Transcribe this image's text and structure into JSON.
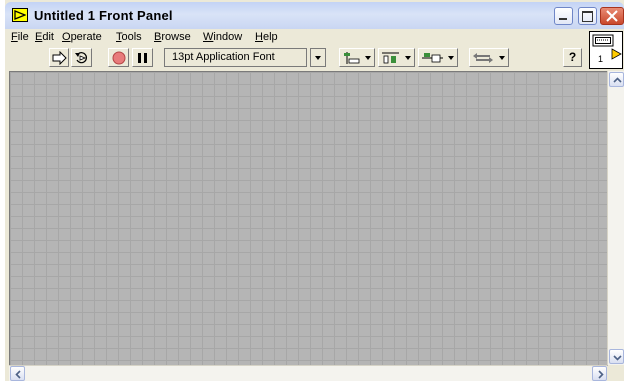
{
  "window": {
    "title": "Untitled 1 Front Panel"
  },
  "menu": [
    {
      "label": "File",
      "mnemonic": "F",
      "rest": "ile"
    },
    {
      "label": "Edit",
      "mnemonic": "E",
      "rest": "dit"
    },
    {
      "label": "Operate",
      "mnemonic": "O",
      "rest": "perate"
    },
    {
      "label": "Tools",
      "mnemonic": "T",
      "rest": "ools"
    },
    {
      "label": "Browse",
      "mnemonic": "B",
      "rest": "rowse"
    },
    {
      "label": "Window",
      "mnemonic": "W",
      "rest": "indow"
    },
    {
      "label": "Help",
      "mnemonic": "H",
      "rest": "elp"
    }
  ],
  "toolbar": {
    "font": "13pt Application Font",
    "help_label": "?"
  },
  "connector": {
    "number": "1"
  },
  "colors": {
    "panel_bg": "#b5b5b5",
    "grid_line": "#a7a7a7",
    "window_bg": "#ece9d8",
    "close_red": "#c9482c"
  }
}
